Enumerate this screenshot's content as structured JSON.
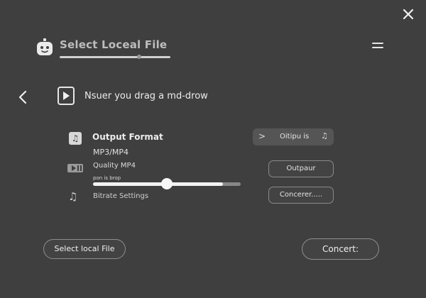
{
  "header": {
    "title": "Select Loceal File",
    "title_progress": 0.72
  },
  "nav": {
    "drag_text": "Nsuer you drag a md-drow"
  },
  "settings": {
    "output_format_label": "Output Format",
    "output_format_value": "MP3/MP4",
    "quality_label": "Quality MP4",
    "slider_hint": "pon is brop",
    "slider_level": 0.5,
    "slider_buffer": 0.88,
    "bitrate_label": "Bitrate Settings"
  },
  "right_buttons": {
    "output_chip_label": "Oitipu is",
    "outpaur_label": "Outpaur",
    "concerer_label": "Concerer....."
  },
  "footer": {
    "select_button_label": "Select local File",
    "concert_button_label": "Concert:"
  },
  "icons": {
    "close": "close-icon",
    "robot": "robot-icon",
    "menu": "menu-icon",
    "back": "chevron-left-icon",
    "play": "play-icon",
    "music_box": "music-note-icon",
    "film": "film-icon",
    "bitrate": "music-note-icon",
    "chip_chevron": "chevron-right-icon",
    "chip_note": "music-note-icon"
  },
  "colors": {
    "background": "#3f3f3f",
    "text": "#e9e9e9",
    "title_text": "#bdbdbd",
    "slider_fill": "#f2f2f2",
    "slider_track": "#888888"
  }
}
